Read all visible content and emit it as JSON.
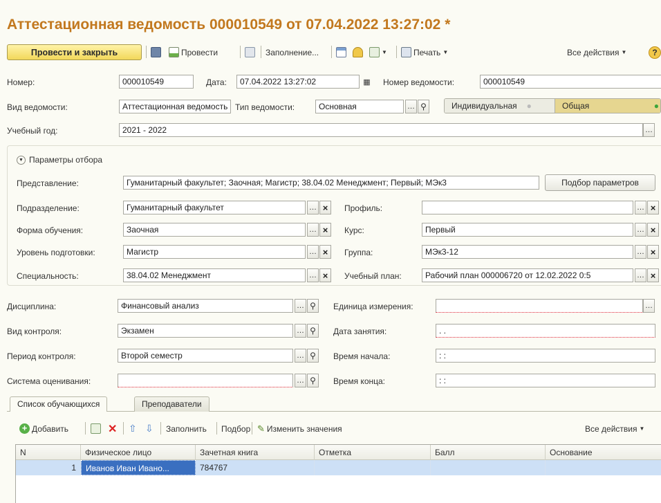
{
  "title": "Аттестационная ведомость 000010549 от 07.04.2022 13:27:02 *",
  "toolbar": {
    "post_close": "Провести и закрыть",
    "post": "Провести",
    "fill": "Заполнение...",
    "print": "Печать",
    "all_actions": "Все действия"
  },
  "header": {
    "number_label": "Номер:",
    "number_value": "000010549",
    "date_label": "Дата:",
    "date_value": "07.04.2022 13:27:02",
    "sheet_number_label": "Номер ведомости:",
    "sheet_number_value": "000010549",
    "sheet_kind_label": "Вид ведомости:",
    "sheet_kind_value": "Аттестационная ведомость",
    "sheet_type_label": "Тип ведомости:",
    "sheet_type_value": "Основная",
    "mode_individual": "Индивидуальная",
    "mode_general": "Общая",
    "year_label": "Учебный год:",
    "year_value": "2021 - 2022"
  },
  "filter": {
    "header": "Параметры отбора",
    "view_label": "Представление:",
    "view_value": "Гуманитарный факультет; Заочная; Магистр; 38.04.02 Менеджмент; Первый; МЭк3",
    "params_button": "Подбор параметров",
    "division_label": "Подразделение:",
    "division_value": "Гуманитарный факультет",
    "profile_label": "Профиль:",
    "profile_value": "",
    "form_label": "Форма обучения:",
    "form_value": "Заочная",
    "course_label": "Курс:",
    "course_value": "Первый",
    "level_label": "Уровень подготовки:",
    "level_value": "Магистр",
    "group_label": "Группа:",
    "group_value": "МЭк3-12",
    "spec_label": "Специальность:",
    "spec_value": "38.04.02 Менеджмент",
    "plan_label": "Учебный план:",
    "plan_value": "Рабочий план 000006720 от 12.02.2022 0:5"
  },
  "details": {
    "discipline_label": "Дисциплина:",
    "discipline_value": "Финансовый анализ",
    "unit_label": "Единица измерения:",
    "unit_value": "",
    "control_label": "Вид контроля:",
    "control_value": "Экзамен",
    "lesson_date_label": "Дата занятия:",
    "lesson_date_value": " . .",
    "period_label": "Период контроля:",
    "period_value": "Второй семестр",
    "start_label": "Время начала:",
    "start_value": " : :",
    "grading_label": "Система оценивания:",
    "grading_value": "",
    "end_label": "Время конца:",
    "end_value": " : :"
  },
  "tabs": [
    "Список обучающихся",
    "Преподаватели"
  ],
  "list_toolbar": {
    "add": "Добавить",
    "fill": "Заполнить",
    "select": "Подбор",
    "change": "Изменить значения",
    "all_actions": "Все действия"
  },
  "table": {
    "columns": [
      "N",
      "Физическое лицо",
      "Зачетная книга",
      "Отметка",
      "Балл",
      "Основание"
    ],
    "rows": [
      {
        "n": "1",
        "person": "Иванов Иван Ивано...",
        "book": "784767",
        "mark": "",
        "score": "",
        "basis": ""
      }
    ]
  },
  "colors": {
    "title": "#c2781e",
    "selected_row": "#cde0f6",
    "primary_button": "#f2d85a"
  }
}
